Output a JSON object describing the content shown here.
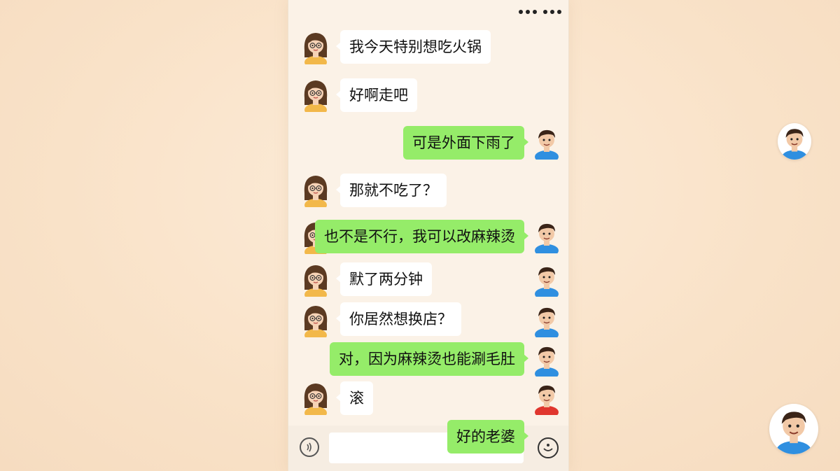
{
  "header": {
    "more_icon": "more-dots-icon"
  },
  "colors": {
    "incoming_bubble": "#ffffff",
    "outgoing_bubble": "#95ec69",
    "background": "#fbf2e7",
    "her_hair": "#5b3a22",
    "her_shirt": "#f2b84a",
    "his_shirt_blue": "#2f8fe0",
    "his_shirt_red": "#e0362e"
  },
  "messages": [
    {
      "sender": "girl",
      "text": "我今天特别想吃火锅"
    },
    {
      "sender": "girl",
      "text": "好啊走吧"
    },
    {
      "sender": "boy",
      "text": "可是外面下雨了"
    },
    {
      "sender": "girl",
      "text": "那就不吃了？"
    },
    {
      "sender": "boy",
      "text": "也不是不行，我可以改麻辣烫"
    },
    {
      "sender": "girl",
      "text": "默了两分钟"
    },
    {
      "sender": "girl",
      "text": "你居然想换店？"
    },
    {
      "sender": "boy",
      "text": "对，因为麻辣烫也能涮毛肚"
    },
    {
      "sender": "girl",
      "text": "滚"
    },
    {
      "sender": "boy",
      "text": "好的老婆"
    }
  ],
  "input_bar": {
    "voice_icon": "voice-icon",
    "emoji_icon": "emoji-icon",
    "text_value": ""
  }
}
